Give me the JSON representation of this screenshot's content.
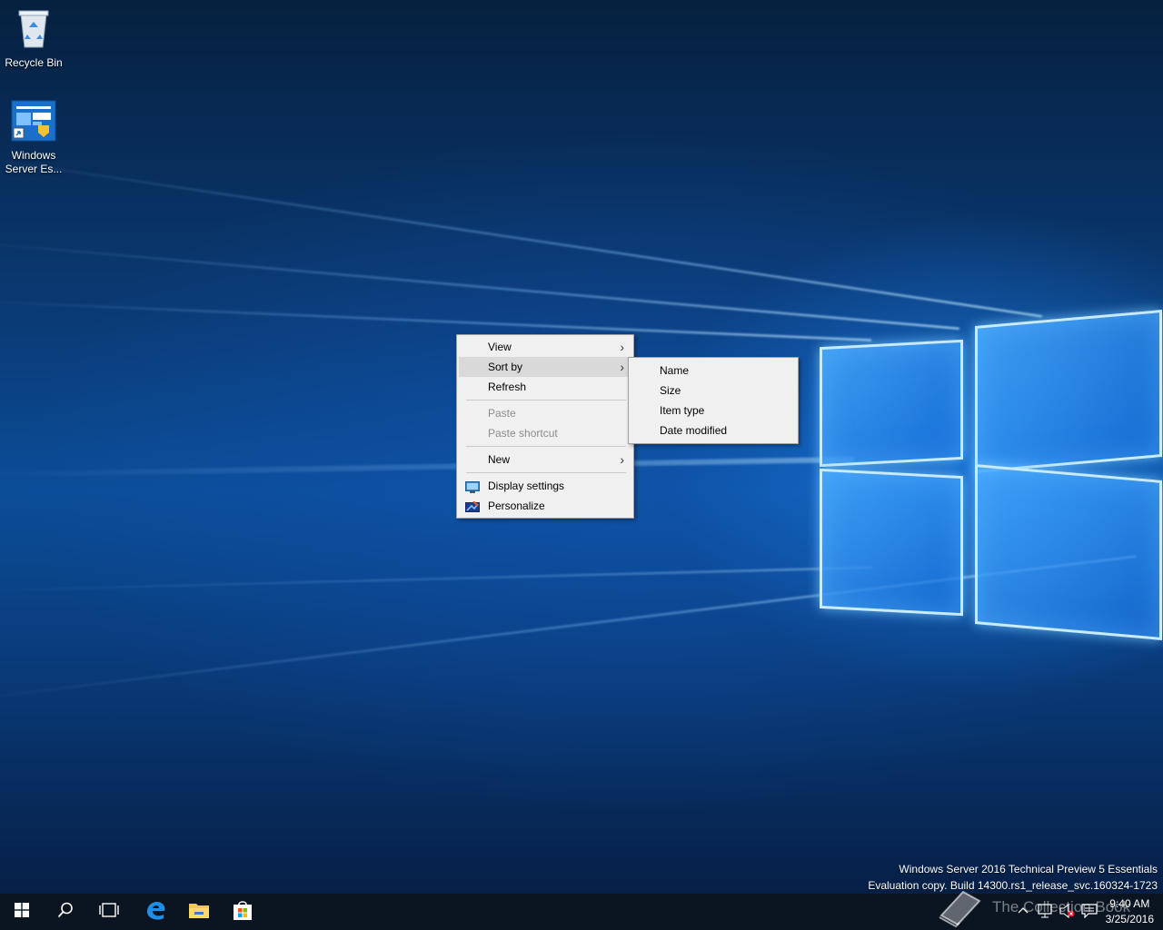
{
  "desktop": {
    "icons": [
      {
        "label": "Recycle Bin",
        "icon": "recycle-bin-icon"
      },
      {
        "label": "Windows Server Es...",
        "icon": "windows-server-essentials-dashboard-icon"
      }
    ]
  },
  "context_menu": {
    "items": [
      {
        "label": "View",
        "has_submenu": true,
        "enabled": true
      },
      {
        "label": "Sort by",
        "has_submenu": true,
        "enabled": true,
        "highlighted": true
      },
      {
        "label": "Refresh",
        "enabled": true
      },
      {
        "label": "Paste",
        "enabled": false
      },
      {
        "label": "Paste shortcut",
        "enabled": false
      },
      {
        "label": "New",
        "has_submenu": true,
        "enabled": true
      },
      {
        "label": "Display settings",
        "icon": "display-settings-icon",
        "enabled": true
      },
      {
        "label": "Personalize",
        "icon": "personalize-icon",
        "enabled": true
      }
    ]
  },
  "sort_submenu": {
    "items": [
      "Name",
      "Size",
      "Item type",
      "Date modified"
    ]
  },
  "watermark": {
    "line1": "Windows Server 2016 Technical Preview 5 Essentials",
    "line2": "Evaluation copy. Build 14300.rs1_release_svc.160324-1723"
  },
  "taskbar": {
    "buttons": [
      "start-icon",
      "search-icon",
      "task-view-icon",
      "edge-icon",
      "file-explorer-icon",
      "store-icon"
    ],
    "tray_icons": [
      "chevron-up-icon",
      "network-icon",
      "volume-muted-icon",
      "action-center-icon"
    ],
    "clock": {
      "time": "9:40 AM",
      "date": "3/25/2016"
    }
  },
  "overlay": {
    "brand": "The Collection Book"
  },
  "colors": {
    "taskbar": "#0b1522",
    "menu_bg": "#f0f0f0",
    "menu_hover": "#d9d9d9",
    "disabled_text": "#8d8d8d"
  }
}
